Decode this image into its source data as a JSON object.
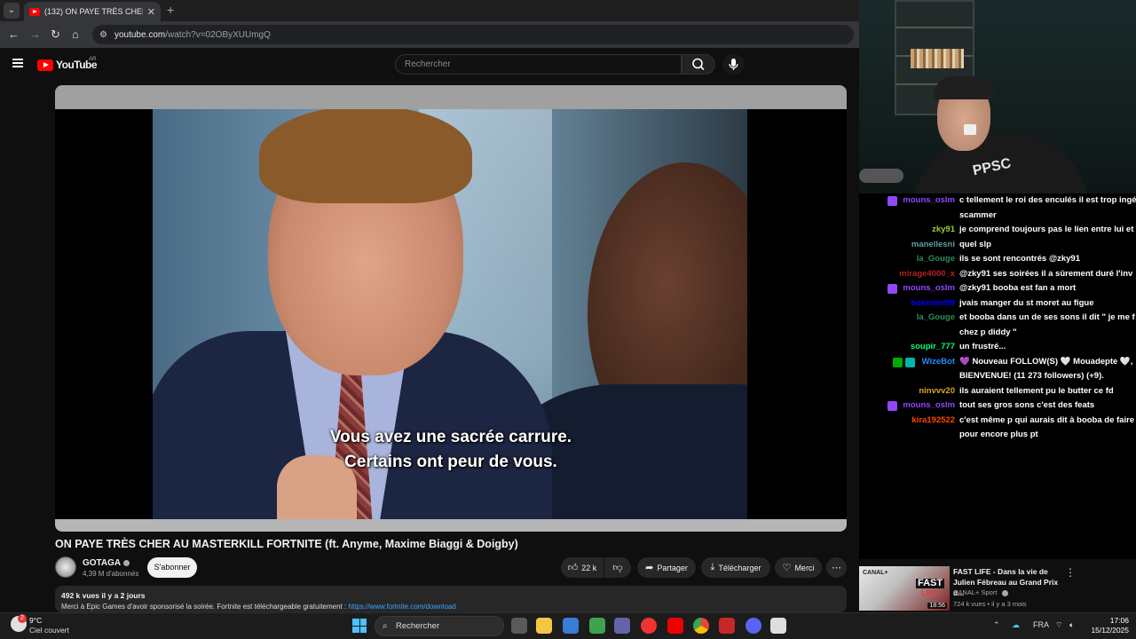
{
  "browser": {
    "tab_title": "(132) ON PAYE TRÈS CHER AU M",
    "url_domain": "youtube.com",
    "url_path": "/watch?v=02OByXUUmgQ"
  },
  "youtube": {
    "logo_text": "YouTube",
    "country": "AR",
    "search_placeholder": "Rechercher"
  },
  "video": {
    "subtitle_line1": "Vous avez une sacrée carrure.",
    "subtitle_line2": "Certains ont peur de vous.",
    "title": "ON PAYE TRÈS CHER AU MASTERKILL FORTNITE (ft. Anyme, Maxime Biaggi & Doigby)",
    "channel_name": "GOTAGA",
    "subscribers": "4,39 M d'abonnés",
    "subscribe_label": "S'abonner",
    "likes": "22 k",
    "share_label": "Partager",
    "download_label": "Télécharger",
    "thanks_label": "Merci",
    "views": "492 k vues",
    "published": "il y a 2 jours",
    "description": "Merci à Epic Games d'avoir sponsorisé la soirée. Fortnite est téléchargeable gratuitement :",
    "description_link": "https://www.fortnite.com/download"
  },
  "webcam": {
    "hoodie_text": "PPSC"
  },
  "chat": [
    {
      "user": "mouns_oslm",
      "color": "#9147ff",
      "badge": "sub",
      "lines": [
        "c tellement le roi des enculés il est trop ingé",
        "scammer"
      ]
    },
    {
      "user": "zky91",
      "color": "#9acd32",
      "badge": "",
      "lines": [
        "je comprend toujours pas le lien entre lui et"
      ]
    },
    {
      "user": "manellesni",
      "color": "#5f9ea0",
      "badge": "",
      "lines": [
        "quel slp"
      ]
    },
    {
      "user": "la_Gouge",
      "color": "#2e8b57",
      "badge": "",
      "lines": [
        "ils se sont rencontrés @zky91"
      ]
    },
    {
      "user": "mirage4000_x",
      "color": "#b22222",
      "badge": "",
      "lines": [
        "@zky91 ses soirées il a sûrement duré l'inv"
      ]
    },
    {
      "user": "mouns_oslm",
      "color": "#9147ff",
      "badge": "sub",
      "lines": [
        "@zky91 booba est fan a mort"
      ]
    },
    {
      "user": "bokmani99",
      "color": "#0000ff",
      "badge": "",
      "lines": [
        "jvais manger du st moret au figue"
      ]
    },
    {
      "user": "la_Gouge",
      "color": "#2e8b57",
      "badge": "",
      "lines": [
        "et booba dans un de ses sons il dit \" je me f",
        "chez p diddy \""
      ]
    },
    {
      "user": "soupir_777",
      "color": "#00ff7f",
      "badge": "",
      "lines": [
        "un frustré..."
      ]
    },
    {
      "user": "WizeBot",
      "color": "#1e90ff",
      "badge": "bot",
      "lines": [
        "💜 Nouveau FOLLOW(S) 🤍 Mouadepte 🤍,",
        "BIENVENUE! (11 273 followers) (+9)."
      ]
    },
    {
      "user": "ninvvv20",
      "color": "#daa520",
      "badge": "",
      "lines": [
        "ils auraient tellement pu le butter ce fd"
      ]
    },
    {
      "user": "mouns_oslm",
      "color": "#9147ff",
      "badge": "sub",
      "lines": [
        "tout ses gros sons c'est des feats"
      ]
    },
    {
      "user": "kira192522",
      "color": "#ff4500",
      "badge": "",
      "lines": [
        "c'est même p qui aurais dit à booba de faire",
        "pour encore plus pt"
      ]
    }
  ],
  "recommended": {
    "title": "FAST LIFE - Dans la vie de Julien Fébreau au Grand Prix d...",
    "channel": "CANAL+ Sport",
    "views": "724 k vues",
    "age": "il y a 3 mois",
    "thumb_brand": "CANAL+",
    "thumb_fast": "FAST",
    "thumb_life": "LIFE",
    "duration": "18:56"
  },
  "taskbar": {
    "temperature": "9°C",
    "weather": "Ciel couvert",
    "weather_badge": "2",
    "search_label": "Rechercher",
    "language": "FRA",
    "time": "17:06",
    "date": "15/12/2025"
  }
}
